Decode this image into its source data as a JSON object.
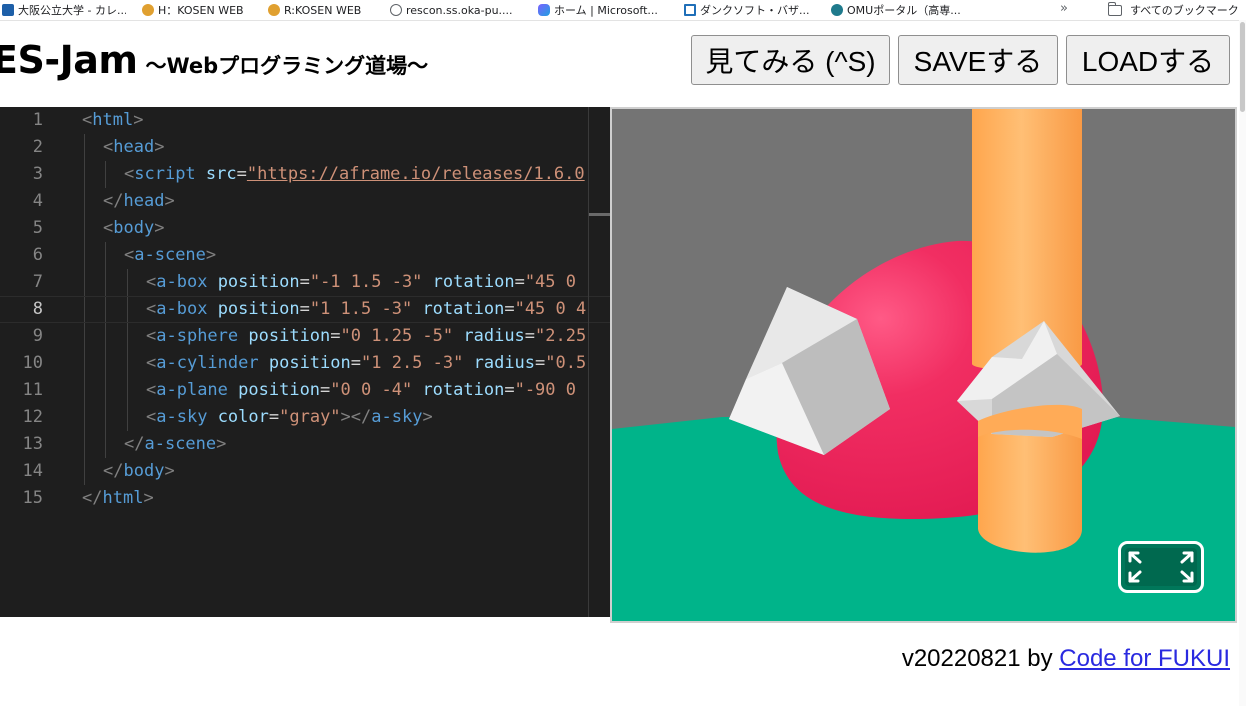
{
  "bookmarks": [
    {
      "label": "大阪公立大学 - カレ...",
      "icon": "osaka-univ-icon",
      "color": "#1d5fa8"
    },
    {
      "label": "H：KOSEN WEB",
      "icon": "kosen-icon",
      "color": "#c0392b"
    },
    {
      "label": "R:KOSEN WEB",
      "icon": "kosen-icon",
      "color": "#c0392b"
    },
    {
      "label": "rescon.ss.oka-pu....",
      "icon": "globe-icon",
      "color": "#5f6368"
    },
    {
      "label": "ホーム | Microsoft...",
      "icon": "microsoft-icon",
      "color": "#7b61ff"
    },
    {
      "label": "ダンクソフト・バザ...",
      "icon": "house-icon",
      "color": "#1f6fb8"
    },
    {
      "label": "OMUポータル（高専...",
      "icon": "sharepoint-icon",
      "color": "#1f7a8c"
    }
  ],
  "bookmarks_more": "»",
  "bookmarks_folder": "すべてのブックマーク",
  "header": {
    "title": "ES-Jam",
    "subtitle": "〜Webプログラミング道場〜",
    "buttons": {
      "view": "見てみる (^S)",
      "save": "SAVEする",
      "load": "LOADする"
    }
  },
  "editor": {
    "active_line": 8,
    "lines": [
      {
        "n": "1"
      },
      {
        "n": "2"
      },
      {
        "n": "3"
      },
      {
        "n": "4"
      },
      {
        "n": "5"
      },
      {
        "n": "6"
      },
      {
        "n": "7"
      },
      {
        "n": "8"
      },
      {
        "n": "9"
      },
      {
        "n": "10"
      },
      {
        "n": "11"
      },
      {
        "n": "12"
      },
      {
        "n": "13"
      },
      {
        "n": "14"
      },
      {
        "n": "15"
      }
    ],
    "code": {
      "l3_url": "\"https://aframe.io/releases/1.6.0",
      "l7_pos": "\"-1 1.5 -3\"",
      "l7_rot": "\"45 0",
      "l8_pos": "\"1 1.5 -3\"",
      "l8_rot": "\"45 0 4",
      "l9_pos": "\"0 1.25 -5\"",
      "l9_rad": "\"2.25",
      "l10_pos": "\"1 2.5 -3\"",
      "l10_rad": "\"0.5",
      "l11_pos": "\"0 0 -4\"",
      "l11_rot": "\"-90 0",
      "l12_color": "\"gray\""
    }
  },
  "preview": {
    "sky_color": "#747474",
    "ground_color": "#00b48a",
    "sphere_color": "#ef2b5c",
    "cylinder_color": "#ffab57",
    "box_color": "#d6d6d6"
  },
  "footer": {
    "version": "v20220821 by ",
    "link": "Code for FUKUI"
  },
  "colors": {
    "editor_bg": "#1e1e1e",
    "link": "#2a2ae0"
  }
}
